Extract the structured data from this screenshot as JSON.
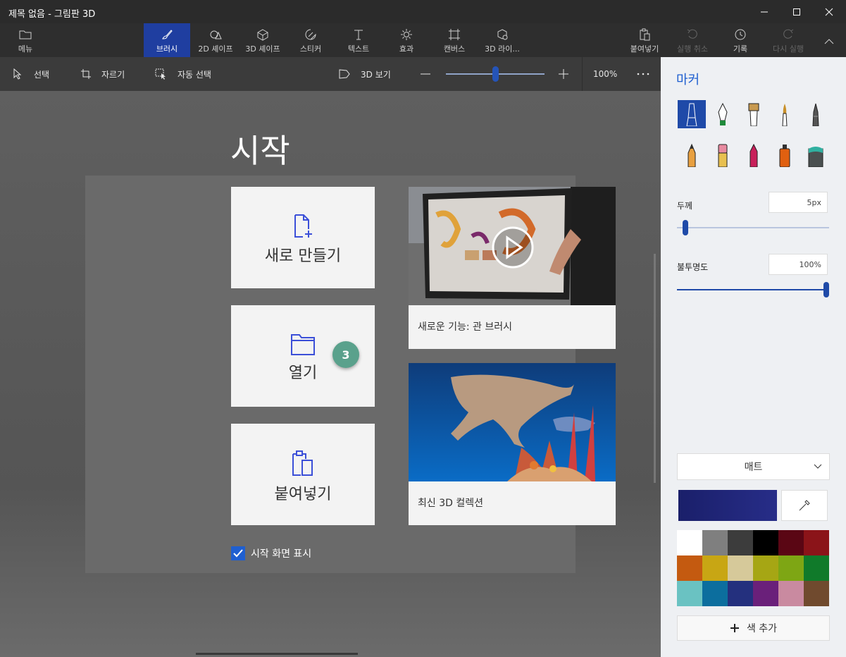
{
  "window": {
    "title": "제목 없음 - 그림판 3D",
    "minimize_icon": "minimize-icon",
    "maximize_icon": "maximize-icon",
    "close_icon": "close-icon"
  },
  "ribbon": {
    "menu": "메뉴",
    "tabs": [
      {
        "label": "브러시",
        "icon": "brush-icon",
        "active": true
      },
      {
        "label": "2D 셰이프",
        "icon": "2d-shapes-icon"
      },
      {
        "label": "3D 셰이프",
        "icon": "3d-shapes-icon"
      },
      {
        "label": "스티커",
        "icon": "sticker-icon"
      },
      {
        "label": "텍스트",
        "icon": "text-icon"
      },
      {
        "label": "효과",
        "icon": "effects-icon"
      },
      {
        "label": "캔버스",
        "icon": "canvas-icon"
      },
      {
        "label": "3D 라이...",
        "icon": "3d-library-icon"
      }
    ],
    "paste": "붙여넣기",
    "undo": "실행 취소",
    "history": "기록",
    "redo": "다시 실행"
  },
  "toolbar": {
    "select": "선택",
    "crop": "자르기",
    "magic_select": "자동 선택",
    "view_3d": "3D 보기",
    "zoom": "100%",
    "zoom_fraction": 0.5
  },
  "start": {
    "title": "시작",
    "new": "새로 만들기",
    "open": "열기",
    "paste": "붙여넣기",
    "badge": "3",
    "video_label": "새로운 기능: 관 브러시",
    "collection_label": "최신 3D 컬렉션",
    "show_start": "시작 화면 표시"
  },
  "panel": {
    "title": "마커",
    "thickness_label": "두께",
    "thickness_value": "5px",
    "thickness_fraction": 0.05,
    "opacity_label": "불투명도",
    "opacity_value": "100%",
    "opacity_fraction": 1.0,
    "finish": "매트",
    "add_color": "색 추가",
    "selected_color": "#1f2378",
    "palette": [
      "#ffffff",
      "#7f7f7f",
      "#3c3c3c",
      "#000000",
      "#5a0614",
      "#8b1419",
      "#c45a10",
      "#c8a614",
      "#d6c99a",
      "#a6a614",
      "#7ea614",
      "#107a2a",
      "#6ac2c2",
      "#0c6e9e",
      "#24307e",
      "#6a207a",
      "#c98aa0",
      "#704a2e"
    ]
  }
}
